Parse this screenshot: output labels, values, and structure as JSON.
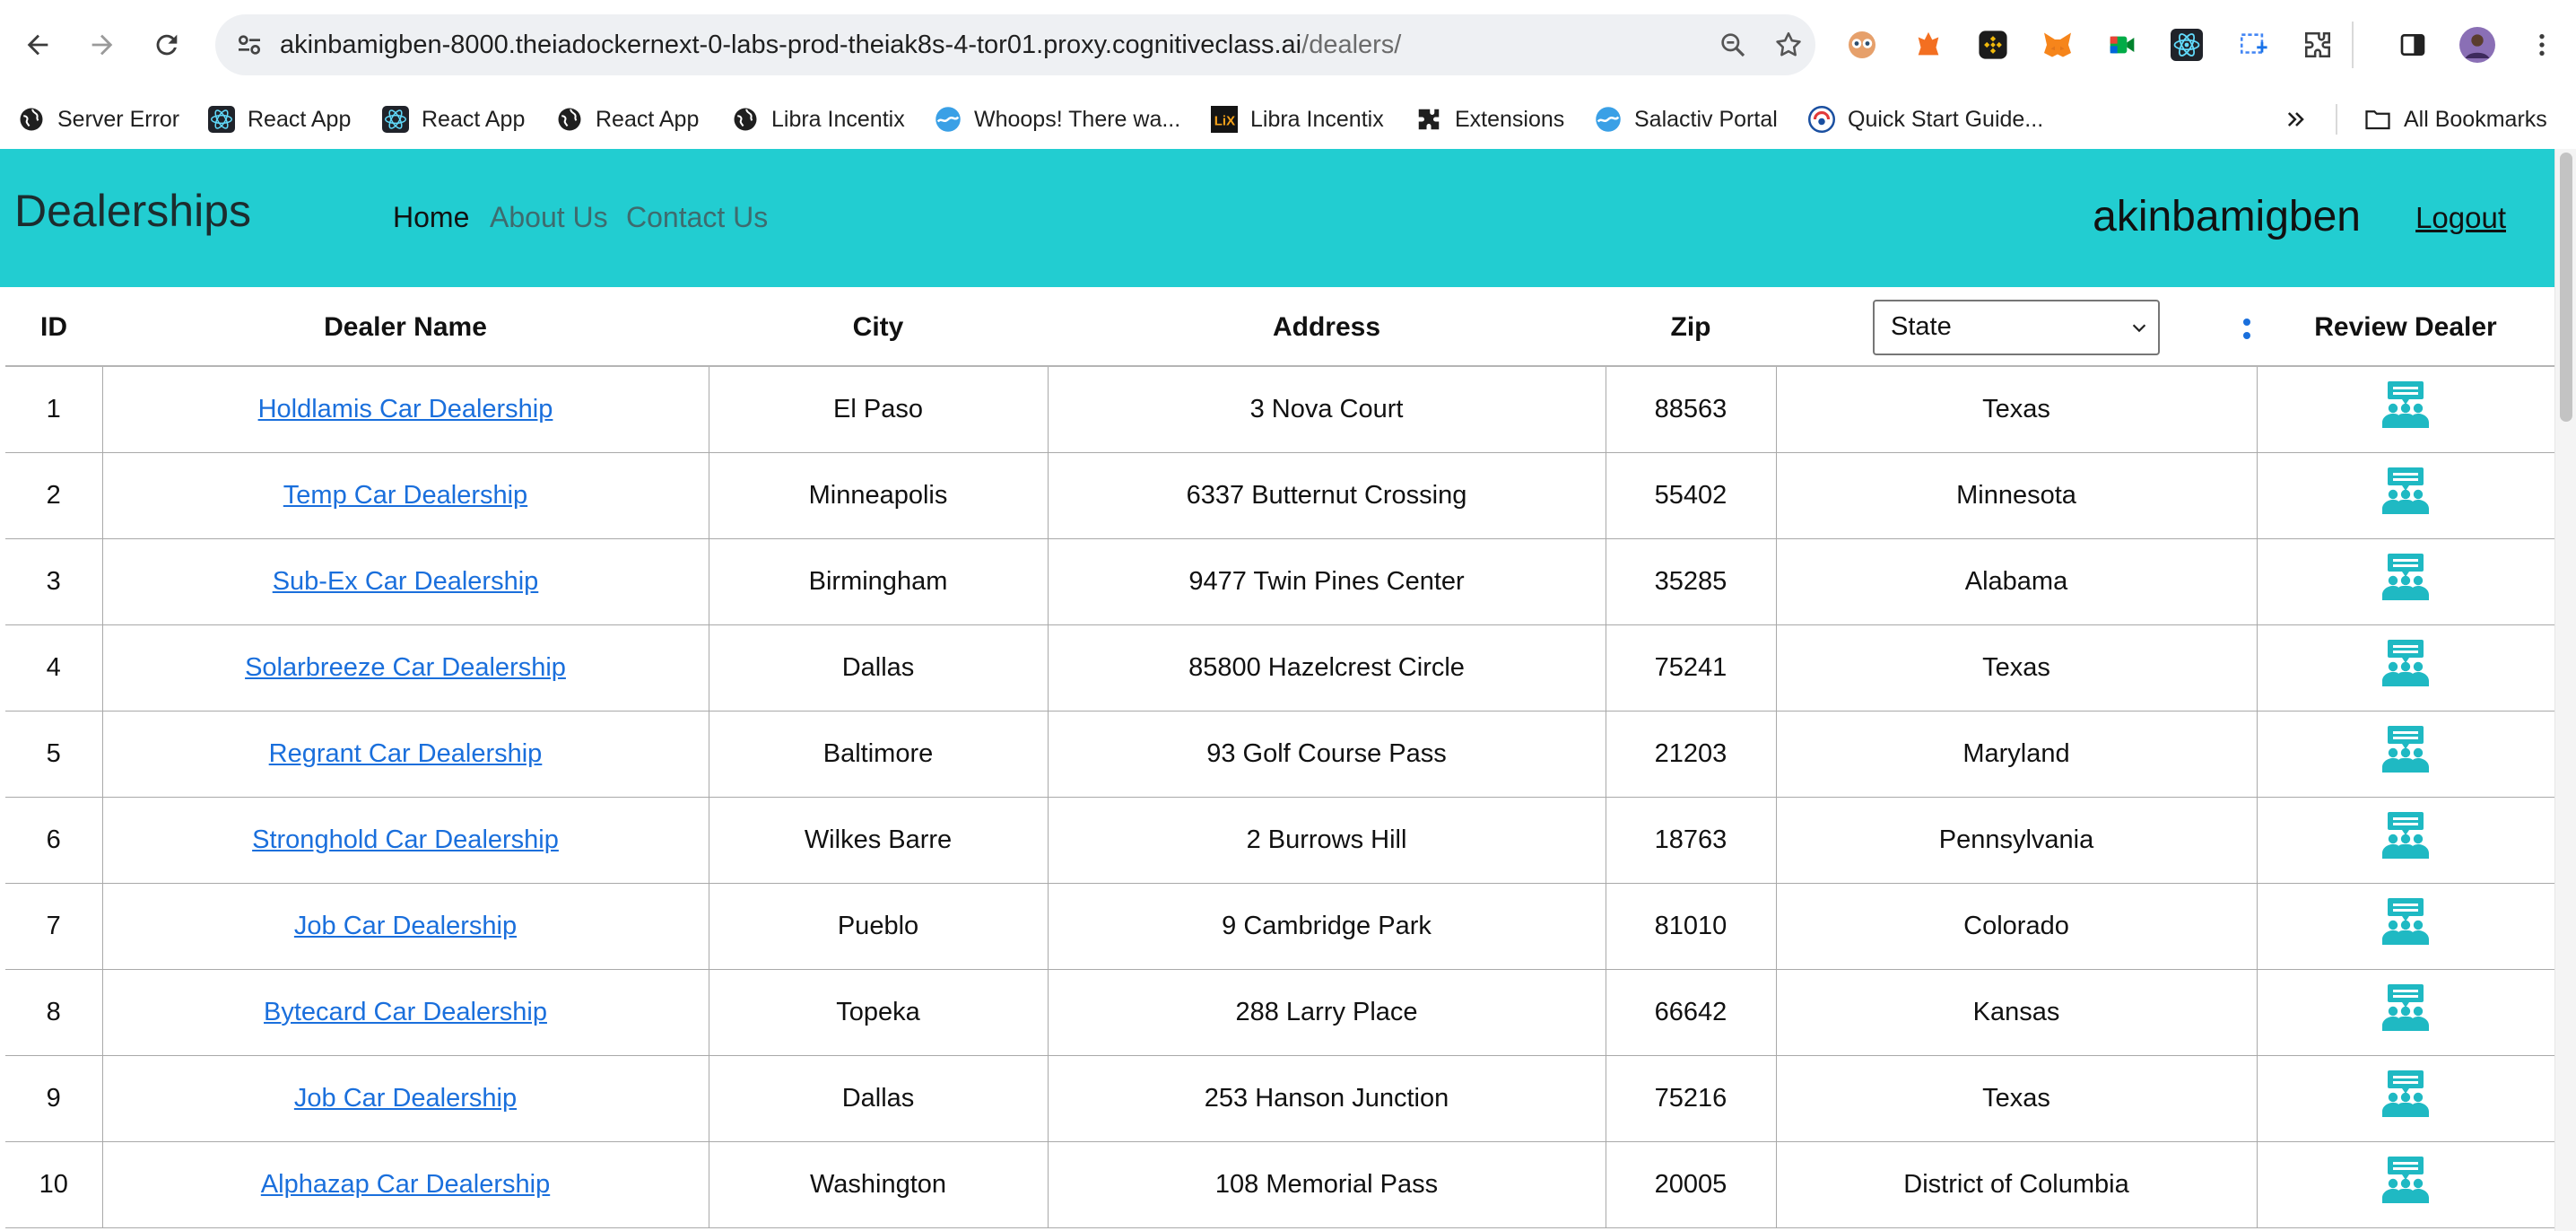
{
  "browser": {
    "url_host": "akinbamigben-8000.theiadockernext-0-labs-prod-theiak8s-4-tor01.proxy.cognitiveclass.ai",
    "url_path": "/dealers/",
    "bookmarks": [
      {
        "label": "Server Error",
        "icon": "globe-icon"
      },
      {
        "label": "React App",
        "icon": "react-icon"
      },
      {
        "label": "React App",
        "icon": "react-icon"
      },
      {
        "label": "React App",
        "icon": "globe-icon"
      },
      {
        "label": "Libra Incentix",
        "icon": "globe-icon"
      },
      {
        "label": "Whoops! There wa...",
        "icon": "wave-icon"
      },
      {
        "label": "Libra Incentix",
        "icon": "lix-icon"
      },
      {
        "label": "Extensions",
        "icon": "puzzle-icon"
      },
      {
        "label": "Salactiv Portal",
        "icon": "wave-icon"
      },
      {
        "label": "Quick Start Guide...",
        "icon": "guide-icon"
      }
    ],
    "all_bookmarks_label": "All Bookmarks"
  },
  "header": {
    "brand": "Dealerships",
    "nav": [
      "Home",
      "About Us",
      "Contact Us"
    ],
    "username": "akinbamigben",
    "logout_label": "Logout"
  },
  "table": {
    "columns": [
      "ID",
      "Dealer Name",
      "City",
      "Address",
      "Zip",
      "State",
      "Review Dealer"
    ],
    "state_filter": "State",
    "rows": [
      {
        "id": "1",
        "name": "Holdlamis Car Dealership",
        "city": "El Paso",
        "address": "3 Nova Court",
        "zip": "88563",
        "state": "Texas"
      },
      {
        "id": "2",
        "name": "Temp Car Dealership",
        "city": "Minneapolis",
        "address": "6337 Butternut Crossing",
        "zip": "55402",
        "state": "Minnesota"
      },
      {
        "id": "3",
        "name": "Sub-Ex Car Dealership",
        "city": "Birmingham",
        "address": "9477 Twin Pines Center",
        "zip": "35285",
        "state": "Alabama"
      },
      {
        "id": "4",
        "name": "Solarbreeze Car Dealership",
        "city": "Dallas",
        "address": "85800 Hazelcrest Circle",
        "zip": "75241",
        "state": "Texas"
      },
      {
        "id": "5",
        "name": "Regrant Car Dealership",
        "city": "Baltimore",
        "address": "93 Golf Course Pass",
        "zip": "21203",
        "state": "Maryland"
      },
      {
        "id": "6",
        "name": "Stronghold Car Dealership",
        "city": "Wilkes Barre",
        "address": "2 Burrows Hill",
        "zip": "18763",
        "state": "Pennsylvania"
      },
      {
        "id": "7",
        "name": "Job Car Dealership",
        "city": "Pueblo",
        "address": "9 Cambridge Park",
        "zip": "81010",
        "state": "Colorado"
      },
      {
        "id": "8",
        "name": "Bytecard Car Dealership",
        "city": "Topeka",
        "address": "288 Larry Place",
        "zip": "66642",
        "state": "Kansas"
      },
      {
        "id": "9",
        "name": "Job Car Dealership",
        "city": "Dallas",
        "address": "253 Hanson Junction",
        "zip": "75216",
        "state": "Texas"
      },
      {
        "id": "10",
        "name": "Alphazap Car Dealership",
        "city": "Washington",
        "address": "108 Memorial Pass",
        "zip": "20005",
        "state": "District of Columbia"
      }
    ]
  },
  "colors": {
    "header_bg": "#22cdd1",
    "link": "#1a6fdc",
    "review_icon": "#1fb9c3"
  }
}
